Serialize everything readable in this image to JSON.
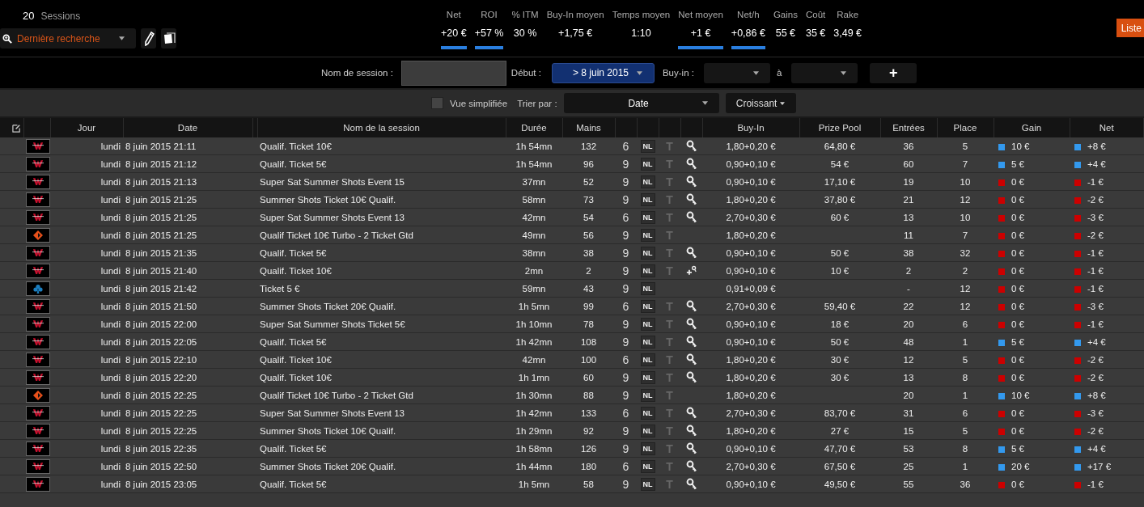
{
  "summary": {
    "count": "20",
    "label": "Sessions"
  },
  "search": {
    "value": "Dernière recherche"
  },
  "stats": [
    {
      "label": "Net",
      "value": "+20 €",
      "underline": true
    },
    {
      "label": "ROI",
      "value": "+57 %",
      "underline": true
    },
    {
      "label": "% ITM",
      "value": "30 %",
      "underline": false
    },
    {
      "label": "Buy-In moyen",
      "value": "+1,75 €",
      "underline": false
    },
    {
      "label": "Temps moyen",
      "value": "1:10",
      "underline": false
    },
    {
      "label": "Net moyen",
      "value": "+1 €",
      "underline": true
    },
    {
      "label": "Net/h",
      "value": "+0,86 €",
      "underline": true
    },
    {
      "label": "Gains",
      "value": "55 €",
      "underline": false
    },
    {
      "label": "Coût",
      "value": "35 €",
      "underline": false
    },
    {
      "label": "Rake",
      "value": "3,49 €",
      "underline": false
    }
  ],
  "list_button": "Liste",
  "filters": {
    "session_label": "Nom de session :",
    "start_label": "Début :",
    "start_value": "> 8 juin 2015",
    "buyin_label": "Buy-in :",
    "to_label": "à",
    "add_button": "+"
  },
  "view": {
    "simplified_label": "Vue simplifiée",
    "simplified_checked": false,
    "sort_label": "Trier par :",
    "sort_value": "Date",
    "order_button": "Croissant"
  },
  "table": {
    "columns": [
      "Jour",
      "Date",
      "Nom de la session",
      "Durée",
      "Mains",
      "Buy-In",
      "Prize Pool",
      "Entrées",
      "Place",
      "Gain",
      "Net"
    ],
    "rows": [
      {
        "room": {
          "kind": "w"
        },
        "day": "lundi",
        "date": "8 juin 2015 21:11",
        "name": "Qualif. Ticket 10€",
        "duration": "1h 54mn",
        "hands": "132",
        "seats": "6",
        "limit": "NL",
        "speed": "T",
        "sat": {
          "kind": "key"
        },
        "buyin": "1,80+0,20 €",
        "prize": "64,80 €",
        "entries": "36",
        "place": "5",
        "gain": {
          "value": "10 €",
          "color": "#3399ee"
        },
        "net": {
          "value": "+8 €",
          "color": "#3399ee"
        }
      },
      {
        "room": {
          "kind": "w"
        },
        "day": "lundi",
        "date": "8 juin 2015 21:12",
        "name": "Qualif. Ticket 5€",
        "duration": "1h 54mn",
        "hands": "96",
        "seats": "9",
        "limit": "NL",
        "speed": "T",
        "sat": {
          "kind": "key"
        },
        "buyin": "0,90+0,10 €",
        "prize": "54 €",
        "entries": "60",
        "place": "7",
        "gain": {
          "value": "5 €",
          "color": "#3399ee"
        },
        "net": {
          "value": "+4 €",
          "color": "#3399ee"
        }
      },
      {
        "room": {
          "kind": "w"
        },
        "day": "lundi",
        "date": "8 juin 2015 21:13",
        "name": "Super Sat Summer Shots Event 15",
        "duration": "37mn",
        "hands": "52",
        "seats": "9",
        "limit": "NL",
        "speed": "T",
        "sat": {
          "kind": "key"
        },
        "buyin": "0,90+0,10 €",
        "prize": "17,10 €",
        "entries": "19",
        "place": "10",
        "gain": {
          "value": "0 €",
          "color": "#cc0000"
        },
        "net": {
          "value": "-1 €",
          "color": "#cc0000"
        }
      },
      {
        "room": {
          "kind": "w"
        },
        "day": "lundi",
        "date": "8 juin 2015 21:25",
        "name": "Summer Shots Ticket 10€ Qualif.",
        "duration": "58mn",
        "hands": "73",
        "seats": "9",
        "limit": "NL",
        "speed": "T",
        "sat": {
          "kind": "key"
        },
        "buyin": "1,80+0,20 €",
        "prize": "37,80 €",
        "entries": "21",
        "place": "12",
        "gain": {
          "value": "0 €",
          "color": "#cc0000"
        },
        "net": {
          "value": "-2 €",
          "color": "#cc0000"
        }
      },
      {
        "room": {
          "kind": "w"
        },
        "day": "lundi",
        "date": "8 juin 2015 21:25",
        "name": "Super Sat Summer Shots Event 13",
        "duration": "42mn",
        "hands": "54",
        "seats": "6",
        "limit": "NL",
        "speed": "T",
        "sat": {
          "kind": "key"
        },
        "buyin": "2,70+0,30 €",
        "prize": "60 €",
        "entries": "13",
        "place": "10",
        "gain": {
          "value": "0 €",
          "color": "#cc0000"
        },
        "net": {
          "value": "-3 €",
          "color": "#cc0000"
        }
      },
      {
        "room": {
          "kind": "diamond"
        },
        "day": "lundi",
        "date": "8 juin 2015 21:25",
        "name": "Qualif Ticket 10€ Turbo - 2 Ticket Gtd",
        "duration": "49mn",
        "hands": "56",
        "seats": "9",
        "limit": "NL",
        "speed": "T",
        "buyin": "1,80+0,20 €",
        "entries": "11",
        "place": "7",
        "gain": {
          "value": "0 €",
          "color": "#cc0000"
        },
        "net": {
          "value": "-2 €",
          "color": "#cc0000"
        }
      },
      {
        "room": {
          "kind": "w"
        },
        "day": "lundi",
        "date": "8 juin 2015 21:35",
        "name": "Qualif. Ticket 5€",
        "duration": "38mn",
        "hands": "38",
        "seats": "9",
        "limit": "NL",
        "speed": "T",
        "sat": {
          "kind": "key"
        },
        "buyin": "0,90+0,10 €",
        "prize": "50 €",
        "entries": "38",
        "place": "32",
        "gain": {
          "value": "0 €",
          "color": "#cc0000"
        },
        "net": {
          "value": "-1 €",
          "color": "#cc0000"
        }
      },
      {
        "room": {
          "kind": "w"
        },
        "day": "lundi",
        "date": "8 juin 2015 21:40",
        "name": "Qualif. Ticket 10€",
        "duration": "2mn",
        "hands": "2",
        "seats": "9",
        "limit": "NL",
        "speed": "T",
        "sat": {
          "kind": "plus"
        },
        "buyin": "0,90+0,10 €",
        "prize": "10 €",
        "entries": "2",
        "place": "2",
        "gain": {
          "value": "0 €",
          "color": "#cc0000"
        },
        "net": {
          "value": "-1 €",
          "color": "#cc0000"
        }
      },
      {
        "room": {
          "kind": "club"
        },
        "day": "lundi",
        "date": "8 juin 2015 21:42",
        "name": "Ticket 5 €",
        "duration": "59mn",
        "hands": "43",
        "seats": "9",
        "limit": "NL",
        "buyin": "0,91+0,09 €",
        "entries": "-",
        "place": "12",
        "gain": {
          "value": "0 €",
          "color": "#cc0000"
        },
        "net": {
          "value": "-1 €",
          "color": "#cc0000"
        }
      },
      {
        "room": {
          "kind": "w"
        },
        "day": "lundi",
        "date": "8 juin 2015 21:50",
        "name": "Summer Shots Ticket 20€ Qualif.",
        "duration": "1h 5mn",
        "hands": "99",
        "seats": "6",
        "limit": "NL",
        "speed": "T",
        "sat": {
          "kind": "key"
        },
        "buyin": "2,70+0,30 €",
        "prize": "59,40 €",
        "entries": "22",
        "place": "12",
        "gain": {
          "value": "0 €",
          "color": "#cc0000"
        },
        "net": {
          "value": "-3 €",
          "color": "#cc0000"
        }
      },
      {
        "room": {
          "kind": "w"
        },
        "day": "lundi",
        "date": "8 juin 2015 22:00",
        "name": "Super Sat Summer Shots Ticket 5€",
        "duration": "1h 10mn",
        "hands": "78",
        "seats": "9",
        "limit": "NL",
        "speed": "T",
        "sat": {
          "kind": "key"
        },
        "buyin": "0,90+0,10 €",
        "prize": "18 €",
        "entries": "20",
        "place": "6",
        "gain": {
          "value": "0 €",
          "color": "#cc0000"
        },
        "net": {
          "value": "-1 €",
          "color": "#cc0000"
        }
      },
      {
        "room": {
          "kind": "w"
        },
        "day": "lundi",
        "date": "8 juin 2015 22:05",
        "name": "Qualif. Ticket 5€",
        "duration": "1h 42mn",
        "hands": "108",
        "seats": "9",
        "limit": "NL",
        "speed": "T",
        "sat": {
          "kind": "key"
        },
        "buyin": "0,90+0,10 €",
        "prize": "50 €",
        "entries": "48",
        "place": "1",
        "gain": {
          "value": "5 €",
          "color": "#3399ee"
        },
        "net": {
          "value": "+4 €",
          "color": "#3399ee"
        }
      },
      {
        "room": {
          "kind": "w"
        },
        "day": "lundi",
        "date": "8 juin 2015 22:10",
        "name": "Qualif. Ticket 10€",
        "duration": "42mn",
        "hands": "100",
        "seats": "6",
        "limit": "NL",
        "speed": "T",
        "sat": {
          "kind": "key"
        },
        "buyin": "1,80+0,20 €",
        "prize": "30 €",
        "entries": "12",
        "place": "5",
        "gain": {
          "value": "0 €",
          "color": "#cc0000"
        },
        "net": {
          "value": "-2 €",
          "color": "#cc0000"
        }
      },
      {
        "room": {
          "kind": "w"
        },
        "day": "lundi",
        "date": "8 juin 2015 22:20",
        "name": "Qualif. Ticket 10€",
        "duration": "1h 1mn",
        "hands": "60",
        "seats": "9",
        "limit": "NL",
        "speed": "T",
        "sat": {
          "kind": "key"
        },
        "buyin": "1,80+0,20 €",
        "prize": "30 €",
        "entries": "13",
        "place": "8",
        "gain": {
          "value": "0 €",
          "color": "#cc0000"
        },
        "net": {
          "value": "-2 €",
          "color": "#cc0000"
        }
      },
      {
        "room": {
          "kind": "diamond"
        },
        "day": "lundi",
        "date": "8 juin 2015 22:25",
        "name": "Qualif Ticket 10€ Turbo - 2 Ticket Gtd",
        "duration": "1h 30mn",
        "hands": "88",
        "seats": "9",
        "limit": "NL",
        "speed": "T",
        "buyin": "1,80+0,20 €",
        "entries": "20",
        "place": "1",
        "gain": {
          "value": "10 €",
          "color": "#3399ee"
        },
        "net": {
          "value": "+8 €",
          "color": "#3399ee"
        }
      },
      {
        "room": {
          "kind": "w"
        },
        "day": "lundi",
        "date": "8 juin 2015 22:25",
        "name": "Super Sat Summer Shots Event 13",
        "duration": "1h 42mn",
        "hands": "133",
        "seats": "6",
        "limit": "NL",
        "speed": "T",
        "sat": {
          "kind": "key"
        },
        "buyin": "2,70+0,30 €",
        "prize": "83,70 €",
        "entries": "31",
        "place": "6",
        "gain": {
          "value": "0 €",
          "color": "#cc0000"
        },
        "net": {
          "value": "-3 €",
          "color": "#cc0000"
        }
      },
      {
        "room": {
          "kind": "w"
        },
        "day": "lundi",
        "date": "8 juin 2015 22:25",
        "name": "Summer Shots Ticket 10€ Qualif.",
        "duration": "1h 29mn",
        "hands": "92",
        "seats": "9",
        "limit": "NL",
        "speed": "T",
        "sat": {
          "kind": "key"
        },
        "buyin": "1,80+0,20 €",
        "prize": "27 €",
        "entries": "15",
        "place": "5",
        "gain": {
          "value": "0 €",
          "color": "#cc0000"
        },
        "net": {
          "value": "-2 €",
          "color": "#cc0000"
        }
      },
      {
        "room": {
          "kind": "w"
        },
        "day": "lundi",
        "date": "8 juin 2015 22:35",
        "name": "Qualif. Ticket 5€",
        "duration": "1h 58mn",
        "hands": "126",
        "seats": "9",
        "limit": "NL",
        "speed": "T",
        "sat": {
          "kind": "key"
        },
        "buyin": "0,90+0,10 €",
        "prize": "47,70 €",
        "entries": "53",
        "place": "8",
        "gain": {
          "value": "5 €",
          "color": "#3399ee"
        },
        "net": {
          "value": "+4 €",
          "color": "#3399ee"
        }
      },
      {
        "room": {
          "kind": "w"
        },
        "day": "lundi",
        "date": "8 juin 2015 22:50",
        "name": "Summer Shots Ticket 20€ Qualif.",
        "duration": "1h 44mn",
        "hands": "180",
        "seats": "6",
        "limit": "NL",
        "speed": "T",
        "sat": {
          "kind": "key"
        },
        "buyin": "2,70+0,30 €",
        "prize": "67,50 €",
        "entries": "25",
        "place": "1",
        "gain": {
          "value": "20 €",
          "color": "#3399ee"
        },
        "net": {
          "value": "+17 €",
          "color": "#3399ee"
        }
      },
      {
        "room": {
          "kind": "w"
        },
        "day": "lundi",
        "date": "8 juin 2015 23:05",
        "name": "Qualif. Ticket 5€",
        "duration": "1h 5mn",
        "hands": "58",
        "seats": "9",
        "limit": "NL",
        "speed": "T",
        "sat": {
          "kind": "key"
        },
        "buyin": "0,90+0,10 €",
        "prize": "49,50 €",
        "entries": "55",
        "place": "36",
        "gain": {
          "value": "0 €",
          "color": "#cc0000"
        },
        "net": {
          "value": "-1 €",
          "color": "#cc0000"
        }
      }
    ]
  }
}
